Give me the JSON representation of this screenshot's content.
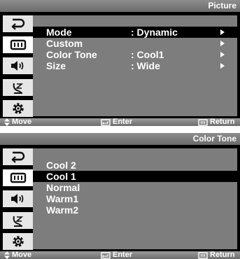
{
  "picture_menu": {
    "title": "Picture",
    "items": [
      {
        "label": "Mode",
        "value": ": Dynamic"
      },
      {
        "label": "Custom",
        "value": ""
      },
      {
        "label": "Color Tone",
        "value": ": Cool1"
      },
      {
        "label": "Size",
        "value": ": Wide"
      }
    ]
  },
  "color_tone_menu": {
    "title": "Color Tone",
    "options": [
      "Cool 2",
      "Cool 1",
      "Normal",
      "Warm1",
      "Warm2"
    ],
    "selected": "Cool 1"
  },
  "bottom_bar": {
    "move_label": "Move",
    "enter_label": "Enter",
    "return_label": "Return"
  },
  "sidebar_icons": [
    "input-icon",
    "picture-icon",
    "sound-icon",
    "channel-icon",
    "setup-icon"
  ],
  "colors": {
    "menu_panel": "#7d7d7d",
    "selection": "#000000",
    "active_icon": "#ffffff",
    "title_bar": "#7a7a7a"
  }
}
